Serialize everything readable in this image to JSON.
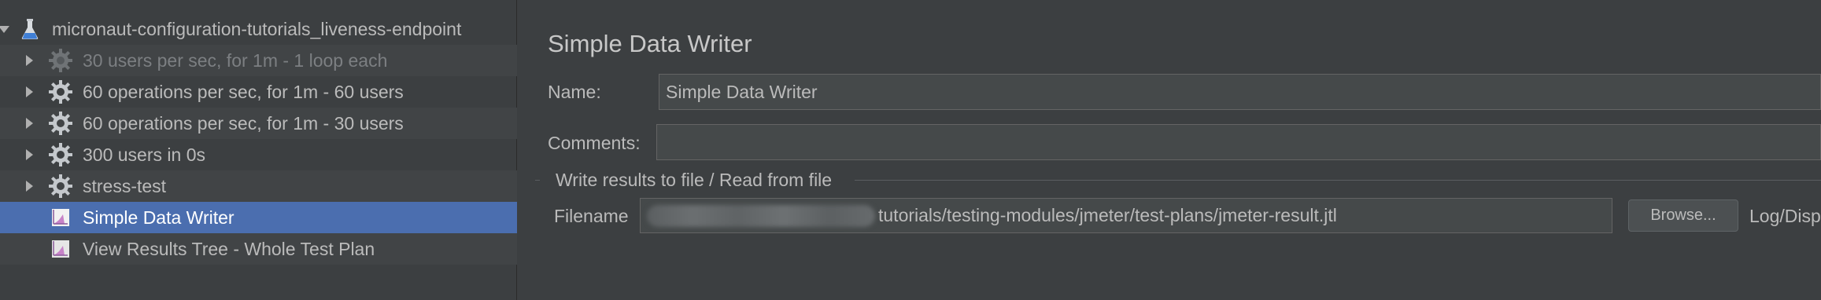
{
  "tree": {
    "root": {
      "label": "micronaut-configuration-tutorials_liveness-endpoint",
      "icon": "flask-icon"
    },
    "items": [
      {
        "label": "30 users per sec, for 1m - 1 loop each",
        "icon": "gear-icon",
        "disabled": true
      },
      {
        "label": "60 operations per sec, for 1m - 60 users",
        "icon": "gear-icon",
        "disabled": false
      },
      {
        "label": "60 operations per sec, for 1m - 30 users",
        "icon": "gear-icon",
        "disabled": false
      },
      {
        "label": "300 users in 0s",
        "icon": "gear-icon",
        "disabled": false
      },
      {
        "label": "stress-test",
        "icon": "gear-icon",
        "disabled": false
      },
      {
        "label": "Simple Data Writer",
        "icon": "chart-icon",
        "selected": true
      },
      {
        "label": "View Results Tree - Whole Test Plan",
        "icon": "chart-icon",
        "selected": false
      }
    ]
  },
  "panel": {
    "title": "Simple Data Writer",
    "name_label": "Name:",
    "name_value": "Simple Data Writer",
    "comments_label": "Comments:",
    "comments_value": "",
    "group_title": "Write results to file / Read from file",
    "filename_label": "Filename",
    "filename_value": "tutorials/testing-modules/jmeter/test-plans/jmeter-result.jtl",
    "browse_label": "Browse...",
    "log_label": "Log/Disp"
  },
  "colors": {
    "background": "#3c3f41",
    "selection": "#4b6eaf",
    "input_bg": "#45494a"
  }
}
